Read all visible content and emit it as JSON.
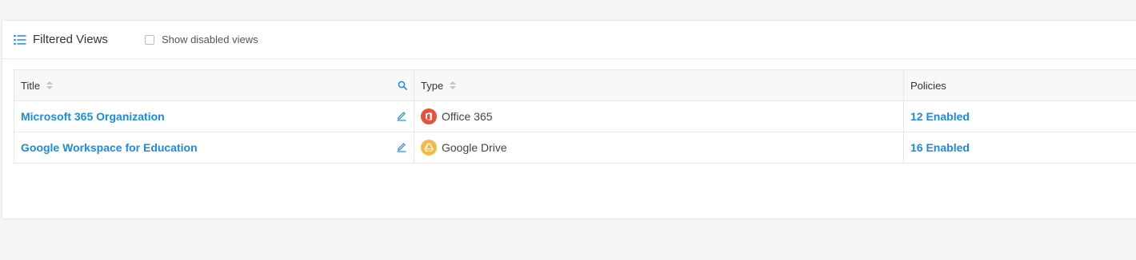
{
  "panel": {
    "title": "Filtered Views",
    "show_disabled_label": "Show disabled views",
    "show_disabled_checked": false
  },
  "table": {
    "columns": {
      "title": "Title",
      "type": "Type",
      "policies": "Policies"
    },
    "rows": [
      {
        "title": "Microsoft 365 Organization",
        "type": "Office 365",
        "type_icon": "office-365-icon",
        "type_color": "#e8503c",
        "policies": "12 Enabled"
      },
      {
        "title": "Google Workspace for Education",
        "type": "Google Drive",
        "type_icon": "google-drive-icon",
        "type_color": "#f5b94a",
        "policies": "16 Enabled"
      }
    ]
  },
  "colors": {
    "link": "#1a8ae8",
    "background": "#f3f4f6"
  }
}
